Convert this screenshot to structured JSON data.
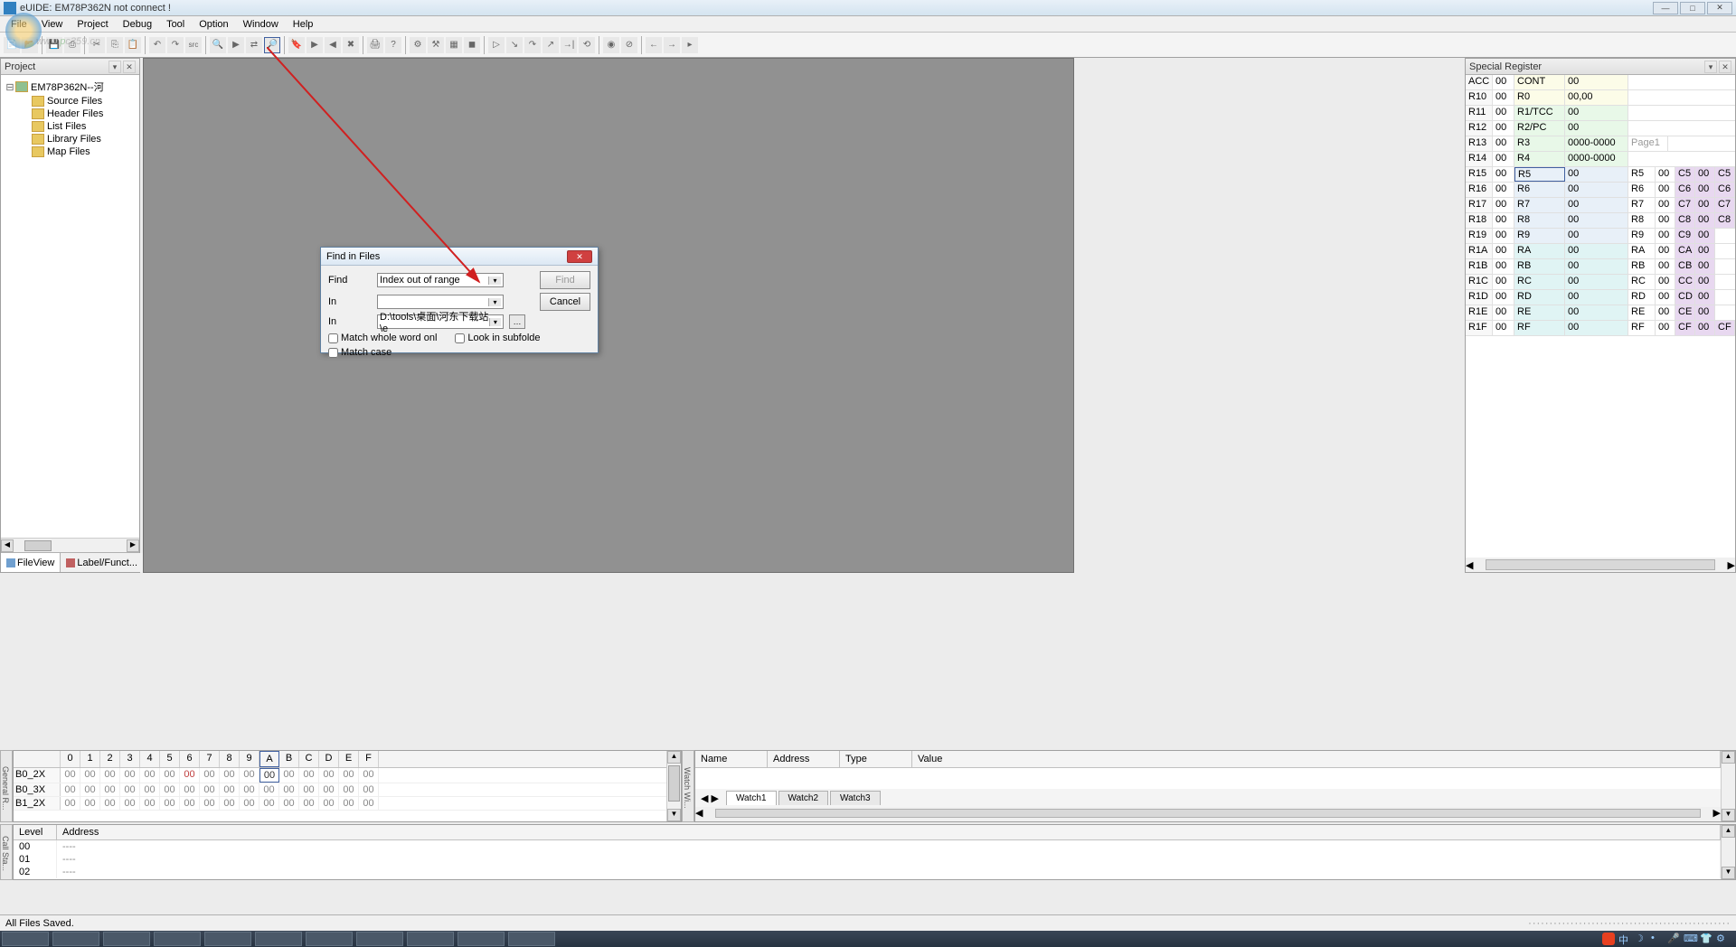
{
  "window": {
    "title": "eUIDE: EM78P362N not connect !"
  },
  "menu": [
    "File",
    "View",
    "Project",
    "Debug",
    "Tool",
    "Option",
    "Window",
    "Help"
  ],
  "watermark": "河东技术网",
  "watermark_addr": "www.",
  "project": {
    "title": "Project",
    "root": "EM78P362N--河",
    "folders": [
      "Source Files",
      "Header Files",
      "List Files",
      "Library Files",
      "Map Files"
    ],
    "tabs": [
      "FileView",
      "Label/Funct..."
    ]
  },
  "register": {
    "title": "Special Register",
    "rows": [
      {
        "r1": "ACC",
        "v1": "00",
        "r2": "CONT",
        "v2": "00"
      },
      {
        "r1": "R10",
        "v1": "00",
        "r2": "R0",
        "v2": "00,00"
      },
      {
        "r1": "R11",
        "v1": "00",
        "r2": "R1/TCC",
        "v2": "00"
      },
      {
        "r1": "R12",
        "v1": "00",
        "r2": "R2/PC",
        "v2": "00"
      },
      {
        "r1": "R13",
        "v1": "00",
        "r2": "R3",
        "v2": "0000-0000",
        "note": "Page1"
      },
      {
        "r1": "R14",
        "v1": "00",
        "r2": "R4",
        "v2": "0000-0000"
      },
      {
        "r1": "R15",
        "v1": "00",
        "r2": "R5",
        "v2": "00",
        "r3": "R5",
        "v3": "00",
        "r4": "C5",
        "v4": "00",
        "r5": "C5"
      },
      {
        "r1": "R16",
        "v1": "00",
        "r2": "R6",
        "v2": "00",
        "r3": "R6",
        "v3": "00",
        "r4": "C6",
        "v4": "00",
        "r5": "C6"
      },
      {
        "r1": "R17",
        "v1": "00",
        "r2": "R7",
        "v2": "00",
        "r3": "R7",
        "v3": "00",
        "r4": "C7",
        "v4": "00",
        "r5": "C7"
      },
      {
        "r1": "R18",
        "v1": "00",
        "r2": "R8",
        "v2": "00",
        "r3": "R8",
        "v3": "00",
        "r4": "C8",
        "v4": "00",
        "r5": "C8"
      },
      {
        "r1": "R19",
        "v1": "00",
        "r2": "R9",
        "v2": "00",
        "r3": "R9",
        "v3": "00",
        "r4": "C9",
        "v4": "00"
      },
      {
        "r1": "R1A",
        "v1": "00",
        "r2": "RA",
        "v2": "00",
        "r3": "RA",
        "v3": "00",
        "r4": "CA",
        "v4": "00"
      },
      {
        "r1": "R1B",
        "v1": "00",
        "r2": "RB",
        "v2": "00",
        "r3": "RB",
        "v3": "00",
        "r4": "CB",
        "v4": "00"
      },
      {
        "r1": "R1C",
        "v1": "00",
        "r2": "RC",
        "v2": "00",
        "r3": "RC",
        "v3": "00",
        "r4": "CC",
        "v4": "00"
      },
      {
        "r1": "R1D",
        "v1": "00",
        "r2": "RD",
        "v2": "00",
        "r3": "RD",
        "v3": "00",
        "r4": "CD",
        "v4": "00"
      },
      {
        "r1": "R1E",
        "v1": "00",
        "r2": "RE",
        "v2": "00",
        "r3": "RE",
        "v3": "00",
        "r4": "CE",
        "v4": "00"
      },
      {
        "r1": "R1F",
        "v1": "00",
        "r2": "RF",
        "v2": "00",
        "r3": "RF",
        "v3": "00",
        "r4": "CF",
        "v4": "00",
        "r5": "CF"
      }
    ]
  },
  "memgrid": {
    "headers": [
      "",
      "0",
      "1",
      "2",
      "3",
      "4",
      "5",
      "6",
      "7",
      "8",
      "9",
      "A",
      "B",
      "C",
      "D",
      "E",
      "F"
    ],
    "rows": [
      {
        "label": "B0_2X",
        "cells": [
          "00",
          "00",
          "00",
          "00",
          "00",
          "00",
          "00",
          "00",
          "00",
          "00",
          "00",
          "00",
          "00",
          "00",
          "00",
          "00"
        ],
        "hlA": true,
        "redIdx": [
          6
        ]
      },
      {
        "label": "B0_3X",
        "cells": [
          "00",
          "00",
          "00",
          "00",
          "00",
          "00",
          "00",
          "00",
          "00",
          "00",
          "00",
          "00",
          "00",
          "00",
          "00",
          "00"
        ]
      },
      {
        "label": "B1_2X",
        "cells": [
          "00",
          "00",
          "00",
          "00",
          "00",
          "00",
          "00",
          "00",
          "00",
          "00",
          "00",
          "00",
          "00",
          "00",
          "00",
          "00"
        ]
      }
    ],
    "vlabel": "General R..."
  },
  "watch": {
    "vlabel": "Watch Wi...",
    "headers": [
      "Name",
      "Address",
      "Type",
      "Value"
    ],
    "tabs": [
      "Watch1",
      "Watch2",
      "Watch3"
    ]
  },
  "callstack": {
    "vlabel": "Call Sta...",
    "headers": [
      "Level",
      "Address"
    ],
    "rows": [
      [
        "00",
        "----"
      ],
      [
        "01",
        "----"
      ],
      [
        "02",
        "----"
      ]
    ]
  },
  "status": {
    "left": "All Files Saved."
  },
  "dialog": {
    "title": "Find in Files",
    "findLabel": "Find",
    "findValue": "Index out of range",
    "inLabel1": "In",
    "inValue1": "",
    "inLabel2": "In",
    "inValue2": "D:\\tools\\桌面\\河东下载站\\e",
    "findBtn": "Find",
    "cancelBtn": "Cancel",
    "chk1": "Match whole word onl",
    "chk2": "Look in subfolde",
    "chk3": "Match case"
  },
  "tray_text": "中"
}
